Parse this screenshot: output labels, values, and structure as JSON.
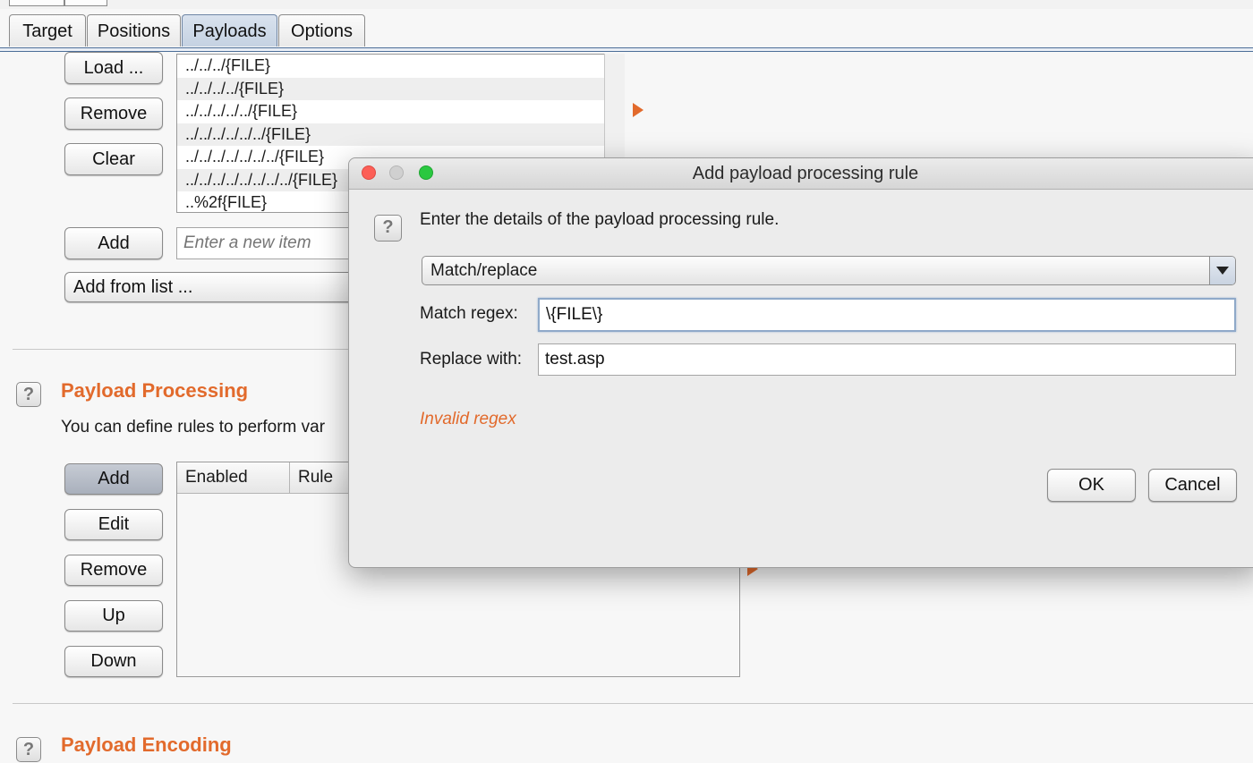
{
  "tabs": [
    {
      "label": "Target",
      "active": false
    },
    {
      "label": "Positions",
      "active": false
    },
    {
      "label": "Payloads",
      "active": true
    },
    {
      "label": "Options",
      "active": false
    }
  ],
  "payload_options": {
    "buttons": {
      "load": "Load ...",
      "remove": "Remove",
      "clear": "Clear",
      "add": "Add"
    },
    "list_items": [
      "../../../{FILE}",
      "../../../../{FILE}",
      "../../../../../{FILE}",
      "../../../../../../{FILE}",
      "../../../../../../../{FILE}",
      "../../../../../../../../{FILE}",
      "..%2f{FILE}"
    ],
    "new_item_placeholder": "Enter a new item",
    "add_from_list": "Add from list ..."
  },
  "payload_processing": {
    "title": "Payload Processing",
    "description": "You can define rules to perform var",
    "buttons": {
      "add": "Add",
      "edit": "Edit",
      "remove": "Remove",
      "up": "Up",
      "down": "Down"
    },
    "columns": [
      "Enabled",
      "Rule"
    ]
  },
  "payload_encoding": {
    "title": "Payload Encoding"
  },
  "help_icon_glyph": "?",
  "dialog": {
    "title": "Add payload processing rule",
    "instruction": "Enter the details of the payload processing rule.",
    "rule_type": "Match/replace",
    "match_regex_label": "Match regex:",
    "match_regex_value": "\\{FILE\\}",
    "replace_with_label": "Replace with:",
    "replace_with_value": "test.asp",
    "error_text": "Invalid regex",
    "ok_label": "OK",
    "cancel_label": "Cancel"
  },
  "colors": {
    "accent": "#e26a2c",
    "tab_active": "#c9d5e4",
    "close_light": "#fc5f57",
    "minimize_light": "#d0d0d0",
    "zoom_light": "#2ac840"
  }
}
